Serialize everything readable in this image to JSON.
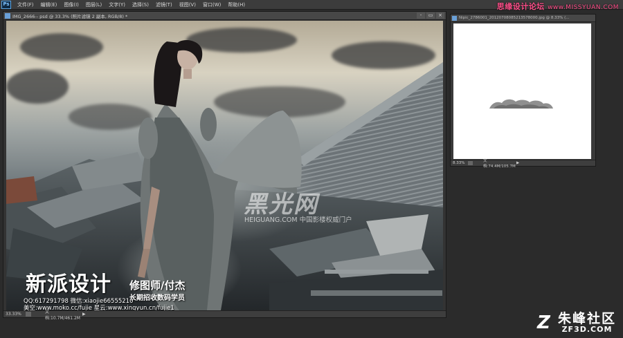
{
  "menubar": {
    "logo": "Ps",
    "items": [
      "文件(F)",
      "编辑(E)",
      "图像(I)",
      "图层(L)",
      "文字(Y)",
      "选择(S)",
      "滤镜(T)",
      "视图(V)",
      "窗口(W)",
      "帮助(H)"
    ]
  },
  "top_watermark": {
    "text": "思缘设计论坛",
    "url": "www.MISSYUAN.COM"
  },
  "main_document": {
    "title": "IMG_2666-- psd @ 33.3% (照片滤镜 2 副本, RGB/8) *",
    "controls": [
      "-",
      "▭",
      "×"
    ],
    "status_zoom": "33.33%",
    "status_info": "文档:10.7M/461.2M",
    "status_arrow": "▶"
  },
  "photo_overlay": {
    "brand_title": "新派设计",
    "brand_role": "修图师/付杰",
    "brand_slogan": "长期招收数码学员",
    "qq_line": "QQ:617291798  微信:xiaojie66555210",
    "site_line": "美空:www.moko.cc/fujie  星云:www.xingyun.cn/fujie1",
    "watermark_logo": "黑光网",
    "watermark_url": "HEIGUANG.COM 中国影楼权威门户"
  },
  "side_document": {
    "title": "Nipic_2786001_20120708085213578000.jpg @ 8.33% (...",
    "status_zoom": "8.33%",
    "status_info": "文档:74.4M/105.7M",
    "status_arrow": "▶"
  },
  "corner_logo": {
    "mark": "Z",
    "cn": "朱峰社区",
    "en": "ZF3D.COM"
  }
}
